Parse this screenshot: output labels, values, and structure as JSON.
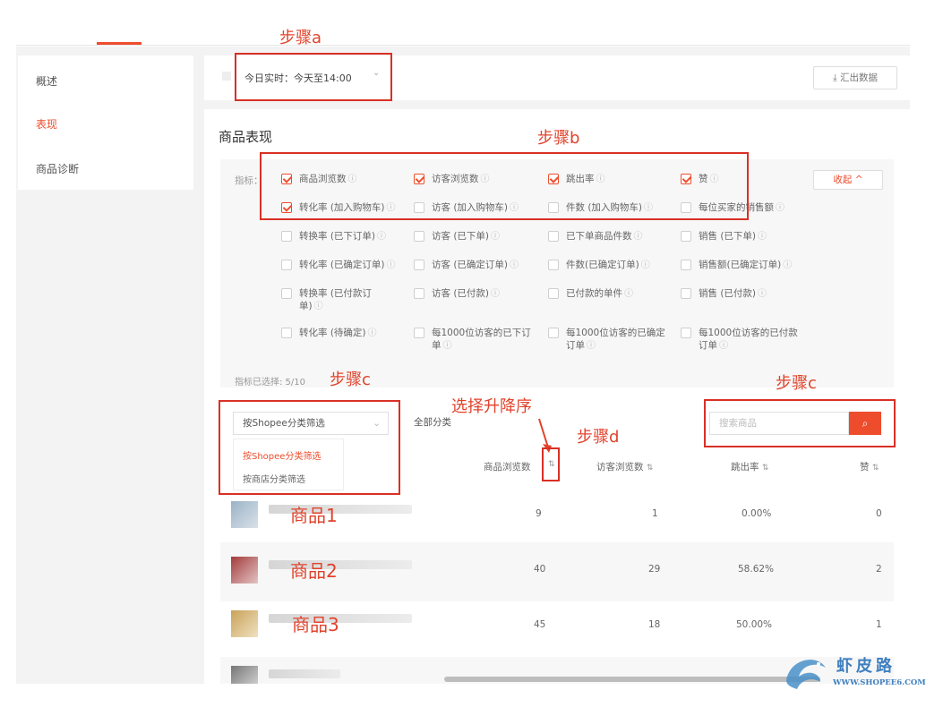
{
  "steps": {
    "a": "步骤a",
    "b": "步骤b",
    "c1": "步骤c",
    "c2": "步骤c",
    "d": "步骤d",
    "sort_hint": "选择升降序"
  },
  "sidebar": {
    "items": [
      {
        "label": "概述",
        "active": false
      },
      {
        "label": "表现",
        "active": true
      },
      {
        "label": "商品诊断",
        "active": false
      }
    ]
  },
  "toolbar": {
    "realtime_label": "今日实时：",
    "realtime_value": "今天至14:00",
    "export_label": "汇出数据"
  },
  "section_title": "商品表现",
  "metrics": {
    "prefix": "指标：",
    "collapse_label": "收起",
    "selected_count": "指标已选择: 5/10",
    "rows": [
      [
        {
          "label": "商品浏览数",
          "checked": true
        },
        {
          "label": "访客浏览数",
          "checked": true
        },
        {
          "label": "跳出率",
          "checked": true
        },
        {
          "label": "赞",
          "checked": true
        }
      ],
      [
        {
          "label": "转化率 (加入购物车)",
          "checked": true
        },
        {
          "label": "访客 (加入购物车)",
          "checked": false
        },
        {
          "label": "件数 (加入购物车)",
          "checked": false
        },
        {
          "label": "每位买家的销售额",
          "checked": false
        }
      ],
      [
        {
          "label": "转换率 (已下订单)",
          "checked": false
        },
        {
          "label": "访客 (已下单)",
          "checked": false
        },
        {
          "label": "已下单商品件数",
          "checked": false
        },
        {
          "label": "销售 (已下单)",
          "checked": false
        }
      ],
      [
        {
          "label": "转化率 (已确定订单)",
          "checked": false
        },
        {
          "label": "访客 (已确定订单)",
          "checked": false
        },
        {
          "label": "件数(已确定订单)",
          "checked": false
        },
        {
          "label": "销售额(已确定订单)",
          "checked": false
        }
      ],
      [
        {
          "label": "转换率 (已付款订单)",
          "checked": false
        },
        {
          "label": "访客 (已付款)",
          "checked": false
        },
        {
          "label": "已付款的单件",
          "checked": false
        },
        {
          "label": "销售 (已付款)",
          "checked": false
        }
      ],
      [
        {
          "label": "转化率 (待确定)",
          "checked": false
        },
        {
          "label": "每1000位访客的已下订单",
          "checked": false
        },
        {
          "label": "每1000位访客的已确定订单",
          "checked": false
        },
        {
          "label": "每1000位访客的已付款订单",
          "checked": false
        }
      ]
    ]
  },
  "filters": {
    "category_select": "按Shopee分类筛选",
    "category_options": [
      "按Shopee分类筛选",
      "按商店分类筛选"
    ],
    "all_categories": "全部分类",
    "search_placeholder": "搜索商品"
  },
  "table": {
    "headers": [
      "商品浏览数",
      "访客浏览数",
      "跳出率",
      "赞"
    ],
    "rows": [
      {
        "name": "商品1",
        "views": "9",
        "visitors": "1",
        "bounce": "0.00%",
        "likes": "0"
      },
      {
        "name": "商品2",
        "views": "40",
        "visitors": "29",
        "bounce": "58.62%",
        "likes": "2"
      },
      {
        "name": "商品3",
        "views": "45",
        "visitors": "18",
        "bounce": "50.00%",
        "likes": "1"
      }
    ]
  },
  "watermark": {
    "brand": "虾皮路",
    "url": "WWW.SHOPEE6.COM"
  },
  "colors": {
    "accent": "#ee4d2d",
    "annotation": "#e0432c"
  }
}
